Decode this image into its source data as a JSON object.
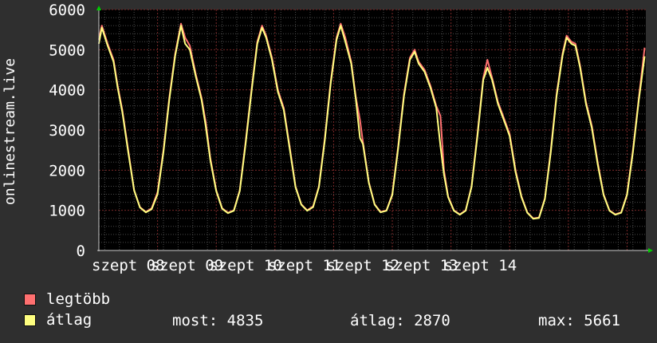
{
  "chart_data": {
    "type": "line",
    "ylabel": "onlinestream.live",
    "ylim": [
      0,
      6000
    ],
    "yticks": [
      "0",
      "1000",
      "2000",
      "3000",
      "4000",
      "5000",
      "6000"
    ],
    "xtick_labels": [
      "szept 08",
      "szept 09",
      "szept 10",
      "szept 11",
      "szept 12",
      "szept 13",
      "szept 14"
    ],
    "grid": true,
    "series": [
      {
        "name": "legtöbb",
        "color": "#ff7070",
        "points": [
          [
            0.0,
            5250
          ],
          [
            0.05,
            5600
          ],
          [
            0.15,
            5150
          ],
          [
            0.25,
            4750
          ],
          [
            0.32,
            4100
          ],
          [
            0.4,
            3500
          ],
          [
            0.5,
            2500
          ],
          [
            0.6,
            1500
          ],
          [
            0.7,
            1080
          ],
          [
            0.8,
            960
          ],
          [
            0.9,
            1050
          ],
          [
            1.0,
            1450
          ],
          [
            1.1,
            2500
          ],
          [
            1.2,
            3800
          ],
          [
            1.3,
            4900
          ],
          [
            1.4,
            5650
          ],
          [
            1.47,
            5300
          ],
          [
            1.55,
            5100
          ],
          [
            1.65,
            4400
          ],
          [
            1.75,
            3800
          ],
          [
            1.82,
            3200
          ],
          [
            1.9,
            2300
          ],
          [
            2.0,
            1500
          ],
          [
            2.1,
            1050
          ],
          [
            2.2,
            940
          ],
          [
            2.3,
            1000
          ],
          [
            2.4,
            1500
          ],
          [
            2.5,
            2700
          ],
          [
            2.6,
            4000
          ],
          [
            2.7,
            5200
          ],
          [
            2.78,
            5600
          ],
          [
            2.85,
            5350
          ],
          [
            2.95,
            4800
          ],
          [
            3.05,
            4000
          ],
          [
            3.15,
            3550
          ],
          [
            3.25,
            2600
          ],
          [
            3.35,
            1600
          ],
          [
            3.45,
            1150
          ],
          [
            3.55,
            1000
          ],
          [
            3.65,
            1100
          ],
          [
            3.75,
            1600
          ],
          [
            3.85,
            2800
          ],
          [
            3.95,
            4200
          ],
          [
            4.05,
            5300
          ],
          [
            4.12,
            5650
          ],
          [
            4.2,
            5300
          ],
          [
            4.3,
            4700
          ],
          [
            4.38,
            3800
          ],
          [
            4.45,
            3250
          ],
          [
            4.5,
            2700
          ],
          [
            4.6,
            1700
          ],
          [
            4.7,
            1150
          ],
          [
            4.8,
            960
          ],
          [
            4.9,
            1000
          ],
          [
            5.0,
            1400
          ],
          [
            5.1,
            2600
          ],
          [
            5.2,
            3900
          ],
          [
            5.3,
            4800
          ],
          [
            5.38,
            5000
          ],
          [
            5.45,
            4700
          ],
          [
            5.55,
            4500
          ],
          [
            5.65,
            4100
          ],
          [
            5.75,
            3600
          ],
          [
            5.82,
            3350
          ],
          [
            5.88,
            2000
          ],
          [
            5.95,
            1350
          ],
          [
            6.05,
            1000
          ],
          [
            6.15,
            900
          ],
          [
            6.25,
            1000
          ],
          [
            6.35,
            1600
          ],
          [
            6.45,
            2900
          ],
          [
            6.55,
            4300
          ],
          [
            6.62,
            4750
          ],
          [
            6.7,
            4300
          ],
          [
            6.8,
            3700
          ],
          [
            6.9,
            3300
          ],
          [
            7.0,
            2900
          ],
          [
            7.1,
            2000
          ],
          [
            7.2,
            1350
          ],
          [
            7.3,
            950
          ],
          [
            7.4,
            800
          ],
          [
            7.5,
            820
          ],
          [
            7.6,
            1300
          ],
          [
            7.7,
            2500
          ],
          [
            7.8,
            3900
          ],
          [
            7.9,
            4900
          ],
          [
            7.97,
            5350
          ],
          [
            8.05,
            5200
          ],
          [
            8.12,
            5150
          ],
          [
            8.2,
            4600
          ],
          [
            8.3,
            3700
          ],
          [
            8.4,
            3100
          ],
          [
            8.5,
            2200
          ],
          [
            8.6,
            1400
          ],
          [
            8.7,
            1000
          ],
          [
            8.8,
            900
          ],
          [
            8.9,
            950
          ],
          [
            9.0,
            1400
          ],
          [
            9.1,
            2500
          ],
          [
            9.2,
            3800
          ],
          [
            9.3,
            5050
          ]
        ]
      },
      {
        "name": "átlag",
        "color": "#ffff80",
        "points": [
          [
            0.0,
            5150
          ],
          [
            0.05,
            5550
          ],
          [
            0.15,
            5100
          ],
          [
            0.25,
            4700
          ],
          [
            0.32,
            4050
          ],
          [
            0.4,
            3450
          ],
          [
            0.5,
            2450
          ],
          [
            0.6,
            1500
          ],
          [
            0.7,
            1070
          ],
          [
            0.8,
            950
          ],
          [
            0.9,
            1030
          ],
          [
            1.0,
            1400
          ],
          [
            1.1,
            2450
          ],
          [
            1.2,
            3750
          ],
          [
            1.3,
            4850
          ],
          [
            1.4,
            5600
          ],
          [
            1.47,
            5150
          ],
          [
            1.55,
            5000
          ],
          [
            1.65,
            4350
          ],
          [
            1.75,
            3750
          ],
          [
            1.82,
            3100
          ],
          [
            1.9,
            2250
          ],
          [
            2.0,
            1480
          ],
          [
            2.1,
            1040
          ],
          [
            2.2,
            930
          ],
          [
            2.3,
            990
          ],
          [
            2.4,
            1480
          ],
          [
            2.5,
            2650
          ],
          [
            2.6,
            3950
          ],
          [
            2.7,
            5150
          ],
          [
            2.78,
            5550
          ],
          [
            2.85,
            5300
          ],
          [
            2.95,
            4750
          ],
          [
            3.05,
            3950
          ],
          [
            3.15,
            3500
          ],
          [
            3.25,
            2550
          ],
          [
            3.35,
            1580
          ],
          [
            3.45,
            1140
          ],
          [
            3.55,
            990
          ],
          [
            3.65,
            1080
          ],
          [
            3.75,
            1580
          ],
          [
            3.85,
            2750
          ],
          [
            3.95,
            4150
          ],
          [
            4.05,
            5250
          ],
          [
            4.12,
            5600
          ],
          [
            4.2,
            5200
          ],
          [
            4.3,
            4650
          ],
          [
            4.38,
            3750
          ],
          [
            4.45,
            2800
          ],
          [
            4.5,
            2650
          ],
          [
            4.6,
            1680
          ],
          [
            4.7,
            1140
          ],
          [
            4.8,
            950
          ],
          [
            4.9,
            990
          ],
          [
            5.0,
            1380
          ],
          [
            5.1,
            2550
          ],
          [
            5.2,
            3850
          ],
          [
            5.3,
            4750
          ],
          [
            5.38,
            4950
          ],
          [
            5.45,
            4650
          ],
          [
            5.55,
            4450
          ],
          [
            5.65,
            4050
          ],
          [
            5.75,
            3550
          ],
          [
            5.82,
            2600
          ],
          [
            5.88,
            1900
          ],
          [
            5.95,
            1330
          ],
          [
            6.05,
            990
          ],
          [
            6.15,
            890
          ],
          [
            6.25,
            990
          ],
          [
            6.35,
            1580
          ],
          [
            6.45,
            2850
          ],
          [
            6.55,
            4250
          ],
          [
            6.62,
            4550
          ],
          [
            6.7,
            4250
          ],
          [
            6.8,
            3650
          ],
          [
            6.9,
            3250
          ],
          [
            7.0,
            2850
          ],
          [
            7.1,
            1950
          ],
          [
            7.2,
            1330
          ],
          [
            7.3,
            940
          ],
          [
            7.4,
            790
          ],
          [
            7.5,
            810
          ],
          [
            7.6,
            1280
          ],
          [
            7.7,
            2450
          ],
          [
            7.8,
            3850
          ],
          [
            7.9,
            4850
          ],
          [
            7.97,
            5300
          ],
          [
            8.05,
            5150
          ],
          [
            8.12,
            5100
          ],
          [
            8.2,
            4550
          ],
          [
            8.3,
            3650
          ],
          [
            8.4,
            3050
          ],
          [
            8.5,
            2150
          ],
          [
            8.6,
            1380
          ],
          [
            8.7,
            990
          ],
          [
            8.8,
            890
          ],
          [
            8.9,
            940
          ],
          [
            9.0,
            1380
          ],
          [
            9.1,
            2450
          ],
          [
            9.2,
            3750
          ],
          [
            9.3,
            4835
          ]
        ]
      }
    ]
  },
  "legend": {
    "items": [
      {
        "label": "legtöbb",
        "color": "#ff7070"
      },
      {
        "label": "átlag",
        "color": "#ffff80"
      }
    ],
    "stats": {
      "most": "most: 4835",
      "atlag": "átlag: 2870",
      "max": "max: 5661"
    }
  }
}
